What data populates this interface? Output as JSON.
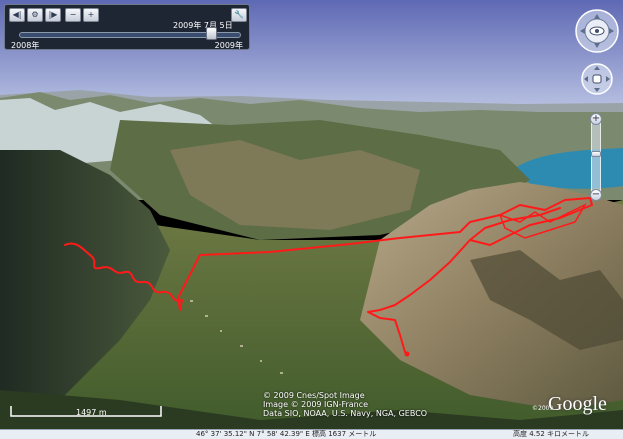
{
  "time_slider": {
    "prev_label": "◀|",
    "settings_label": "⚙",
    "next_label": "|▶",
    "zoom_out_label": "−",
    "zoom_in_label": "+",
    "wrench_label": "🔧",
    "current_date": "2009年 7月 5日",
    "range_start": "2008年",
    "range_end": "2009年"
  },
  "navigation": {
    "look_icon": "eye-icon",
    "move_icon": "hand-icon",
    "zoom_in_label": "+",
    "zoom_out_label": "−"
  },
  "scale": {
    "label": "1497 m"
  },
  "copyright": {
    "line1": "© 2009 Cnes/Spot Image",
    "line2": "Image © 2009 IGN-France",
    "line3": "Data SIO, NOAA, U.S. Navy, NGA, GEBCO"
  },
  "logo": {
    "year": "©2009",
    "text": "Google"
  },
  "status": {
    "coordinates": "46° 37' 35.12\" N    7° 58' 42.39\" E   標高 1637 メートル",
    "altitude": "高度   4.52 キロメートル"
  },
  "colors": {
    "route": "#ff1a1a",
    "sky": "#8d99c8",
    "lake": "#2d8ab0"
  }
}
